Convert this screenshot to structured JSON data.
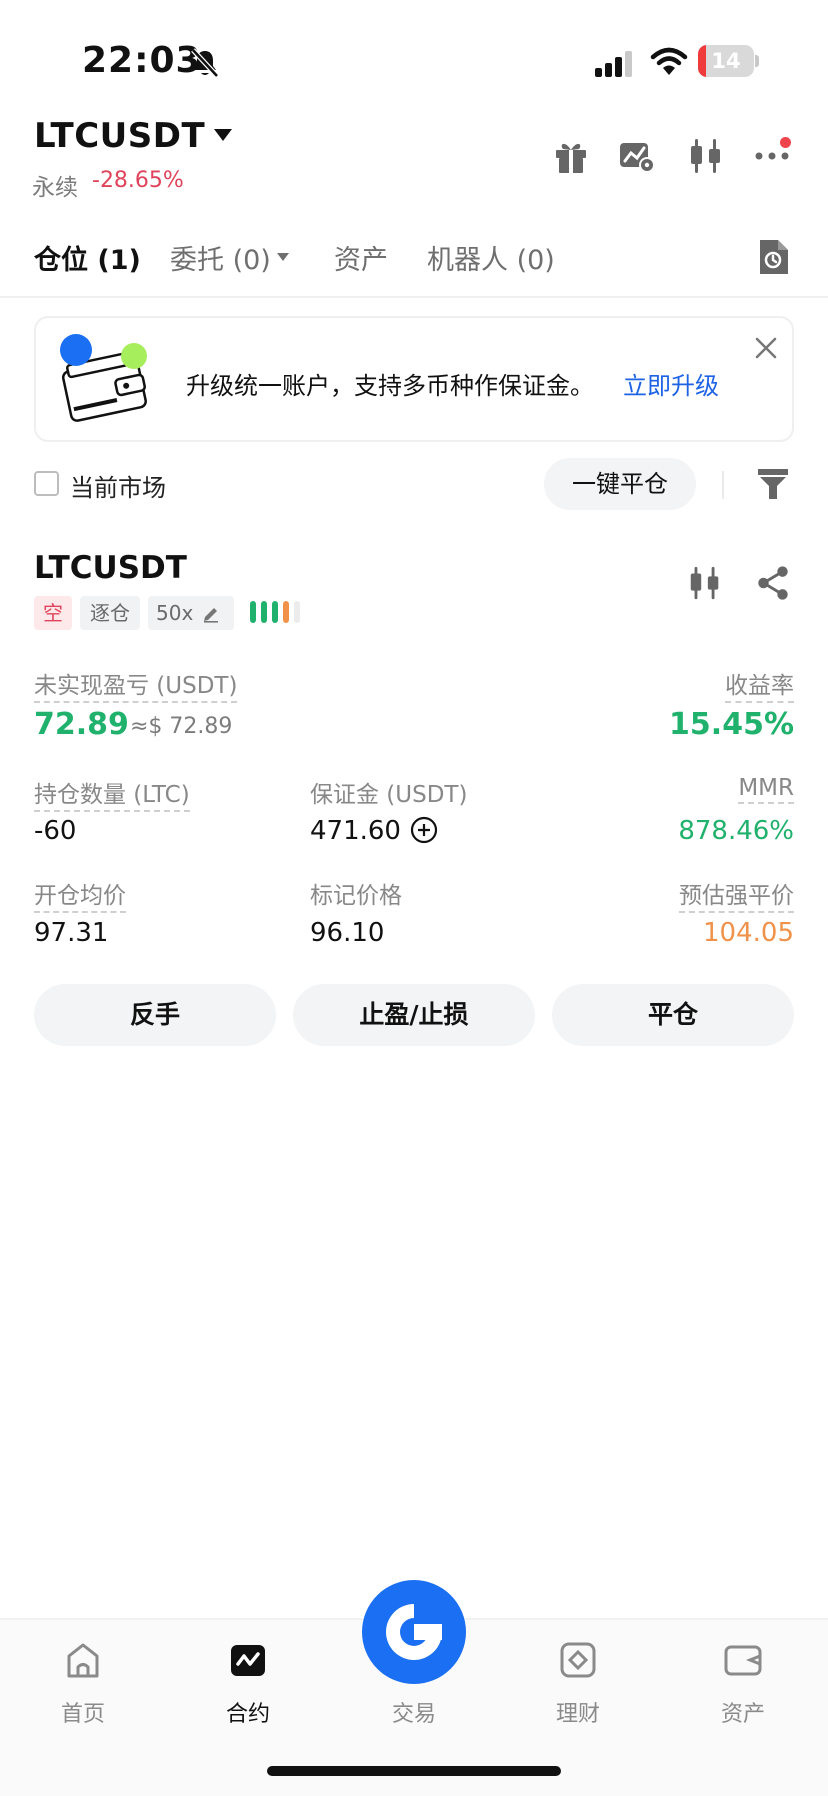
{
  "status_bar": {
    "time": "22:03",
    "battery_level": "14",
    "battery_fraction": 0.14,
    "icons": [
      "bell-muted-icon",
      "cellular-signal-icon",
      "wifi-icon",
      "battery-icon"
    ]
  },
  "header": {
    "symbol": "LTCUSDT",
    "contract_type": "永续",
    "change_pct": "-28.65%",
    "actions": [
      "gift-icon",
      "chart-settings-icon",
      "candlestick-icon",
      "more-icon"
    ],
    "has_notification_dot": true
  },
  "tabs": [
    {
      "label": "仓位 (1)",
      "active": true
    },
    {
      "label": "委托 (0)",
      "active": false
    },
    {
      "label": "资产",
      "active": false
    },
    {
      "label": "机器人 (0)",
      "active": false
    }
  ],
  "banner": {
    "text": "升级统一账户，支持多币种作保证金。",
    "link": "立即升级"
  },
  "filter": {
    "checkbox_label": "当前市场",
    "checked": false,
    "close_all_label": "一键平仓"
  },
  "position": {
    "symbol": "LTCUSDT",
    "side": "空",
    "margin_mode": "逐仓",
    "leverage": "50x",
    "adl_level": 4,
    "adl_colors": [
      "#20b26c",
      "#20b26c",
      "#20b26c",
      "#f0924a"
    ],
    "unrealized_pnl_label": "未实现盈亏 (USDT)",
    "unrealized_pnl": "72.89",
    "unrealized_pnl_usd": "≈$ 72.89",
    "roe_label": "收益率",
    "roe": "15.45%",
    "size_label": "持仓数量 (LTC)",
    "size": "-60",
    "margin_label": "保证金 (USDT)",
    "margin": "471.60",
    "mmr_label": "MMR",
    "mmr": "878.46%",
    "entry_label": "开仓均价",
    "entry_price": "97.31",
    "mark_label": "标记价格",
    "mark_price": "96.10",
    "liq_label": "预估强平价",
    "liq_price": "104.05",
    "buttons": {
      "reverse": "反手",
      "tp_sl": "止盈/止损",
      "close": "平仓"
    }
  },
  "bottom_nav": [
    {
      "label": "首页",
      "icon": "home-icon",
      "active": false
    },
    {
      "label": "合约",
      "icon": "futures-icon",
      "active": true
    },
    {
      "label": "交易",
      "icon": "trade-logo-icon",
      "active": false
    },
    {
      "label": "理财",
      "icon": "earn-icon",
      "active": false
    },
    {
      "label": "资产",
      "icon": "wallet-icon",
      "active": false
    }
  ],
  "colors": {
    "green": "#20b26c",
    "red": "#e0445c",
    "orange": "#f0924a",
    "blue": "#1e63e6",
    "fab": "#1b6ff2"
  }
}
